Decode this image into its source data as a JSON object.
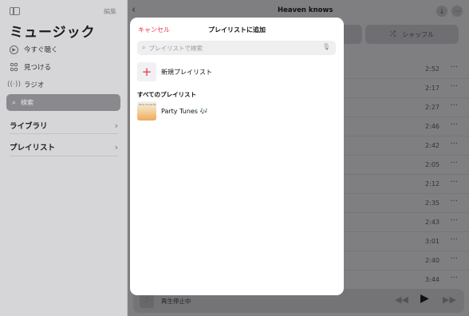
{
  "sidebar": {
    "edit_label": "編集",
    "title": "ミュージック",
    "nav": [
      {
        "label": "今すぐ聴く",
        "icon": "play-circle-icon"
      },
      {
        "label": "見つける",
        "icon": "grid-icon"
      },
      {
        "label": "ラジオ",
        "icon": "radio-waves-icon"
      }
    ],
    "search": {
      "label": "検索",
      "icon": "search-icon"
    },
    "sections": [
      {
        "label": "ライブラリ"
      },
      {
        "label": "プレイリスト"
      }
    ]
  },
  "header": {
    "album_title": "Heaven knows"
  },
  "main": {
    "shuffle_label": "シャッフル",
    "tracks": [
      {
        "duration": "2:52"
      },
      {
        "duration": "2:17"
      },
      {
        "duration": "2:27"
      },
      {
        "duration": "2:46"
      },
      {
        "duration": "2:42"
      },
      {
        "duration": "2:05"
      },
      {
        "duration": "2:12"
      },
      {
        "duration": "2:35"
      },
      {
        "duration": "2:43"
      },
      {
        "duration": "3:01"
      },
      {
        "duration": "2:40"
      },
      {
        "duration": "3:44"
      }
    ]
  },
  "player": {
    "status": "再生停止中"
  },
  "modal": {
    "cancel_label": "キャンセル",
    "title": "プレイリストに追加",
    "search_placeholder": "プレイリストで検索",
    "new_playlist_label": "新規プレイリスト",
    "section_title": "すべてのプレイリスト",
    "playlists": [
      {
        "name": "Party Tunes 🎶",
        "art_text": "Party Tunes 🎶"
      }
    ]
  },
  "colors": {
    "accent": "#e8314b",
    "sidebar_bg": "#d6d6d9",
    "dim_bg": "#7f7f82",
    "modal_bg": "#ffffff"
  }
}
